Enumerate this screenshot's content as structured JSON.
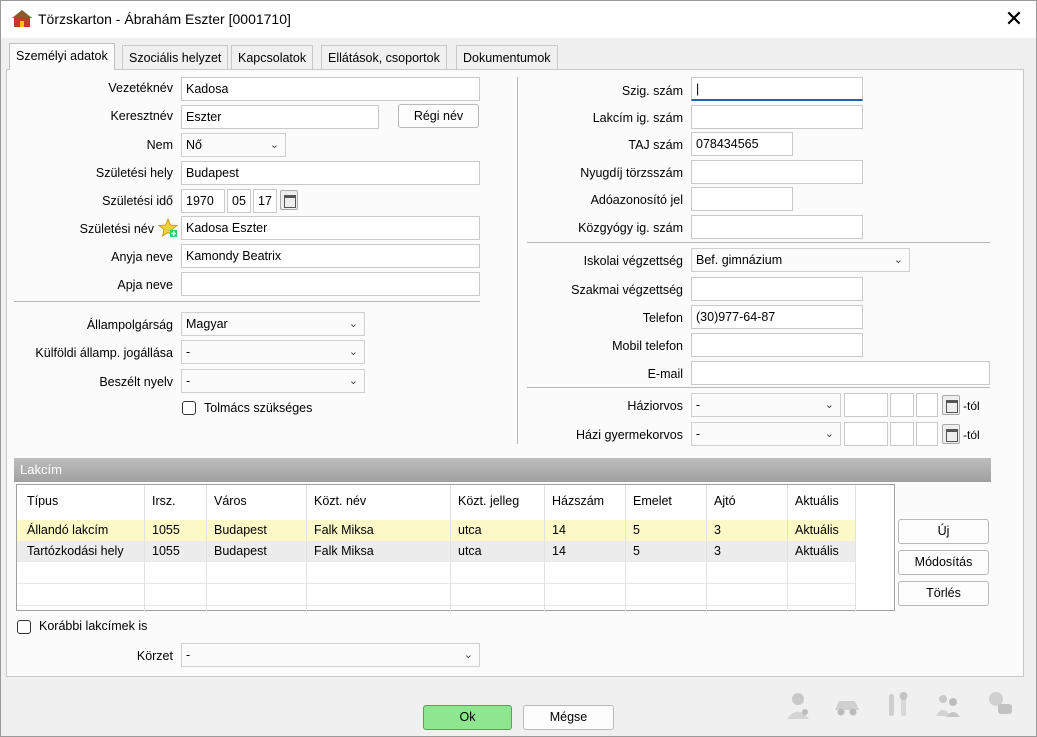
{
  "window": {
    "title": "Törzskarton - Ábrahám Eszter [0001710]",
    "close": "✕"
  },
  "tabs": [
    {
      "label": "Személyi adatok"
    },
    {
      "label": "Szociális helyzet"
    },
    {
      "label": "Kapcsolatok"
    },
    {
      "label": "Ellátások, csoportok"
    },
    {
      "label": "Dokumentumok"
    }
  ],
  "personal": {
    "vezeteknev_label": "Vezetéknév",
    "vezeteknev": "Kadosa",
    "keresztnev_label": "Keresztnév",
    "keresztnev": "Eszter",
    "regi_nev_button": "Régi név",
    "nem_label": "Nem",
    "nem": "Nő",
    "szuletesi_hely_label": "Születési hely",
    "szuletesi_hely": "Budapest",
    "szuletesi_ido_label": "Születési idő",
    "ev": "1970",
    "ho": "05",
    "nap": "17",
    "szuletesi_nev_label": "Születési név",
    "szuletesi_nev": "Kadosa Eszter",
    "anyja_neve_label": "Anyja neve",
    "anyja_neve": "Kamondy Beatrix",
    "apja_neve_label": "Apja neve",
    "apja_neve": "",
    "allampolgarsag_label": "Állampolgárság",
    "allampolgarsag": "Magyar",
    "kulfoldi_label": "Külföldi államp. jogállása",
    "kulfoldi": "-",
    "beszelt_nyelv_label": "Beszélt nyelv",
    "beszelt_nyelv": "-",
    "tolmacs_label": "Tolmács szükséges"
  },
  "ids": {
    "szig_label": "Szig. szám",
    "szig": "|",
    "lakcim_ig_label": "Lakcím ig. szám",
    "lakcim_ig": "",
    "taj_label": "TAJ szám",
    "taj": "078434565",
    "nyugdij_label": "Nyugdíj törzsszám",
    "nyugdij": "",
    "ado_label": "Adóazonosító jel",
    "ado": "",
    "kozgyogy_label": "Közgyógy ig. szám",
    "kozgyogy": "",
    "iskolai_label": "Iskolai végzettség",
    "iskolai": "Bef. gimnázium",
    "szakmai_label": "Szakmai végzettség",
    "szakmai": "",
    "telefon_label": "Telefon",
    "telefon": "(30)977-64-87",
    "mobil_label": "Mobil telefon",
    "mobil": "",
    "email_label": "E-mail",
    "email": "",
    "haziorvos_label": "Háziorvos",
    "haziorvos": "-",
    "hazi_gyermek_label": "Házi gyermekorvos",
    "hazi_gyermek": "-",
    "tol": "-tól"
  },
  "address": {
    "section_title": "Lakcím",
    "columns": [
      "Típus",
      "Irsz.",
      "Város",
      "Közt. név",
      "Közt. jelleg",
      "Házszám",
      "Emelet",
      "Ajtó",
      "Aktuális"
    ],
    "rows": [
      [
        "Állandó lakcím",
        "1055",
        "Budapest",
        "Falk Miksa",
        "utca",
        "14",
        "5",
        "3",
        "Aktuális"
      ],
      [
        "Tartózkodási hely",
        "1055",
        "Budapest",
        "Falk Miksa",
        "utca",
        "14",
        "5",
        "3",
        "Aktuális"
      ]
    ],
    "uj_button": "Új",
    "modositas_button": "Módosítás",
    "torles_button": "Törlés",
    "korabbi_label": "Korábbi lakcímek is",
    "korzet_label": "Körzet",
    "korzet": "-"
  },
  "footer": {
    "ok_button": "Ok",
    "megse_button": "Mégse",
    "icons": [
      "doctor-icon",
      "car-icon",
      "tools-icon",
      "people-icon",
      "assistant-icon"
    ]
  },
  "colors": {
    "ok_button": "#8ee68e",
    "selected_row": "#fcf8c8",
    "section_bar": "#a8a8a8",
    "focus": "#1f5fb4"
  }
}
